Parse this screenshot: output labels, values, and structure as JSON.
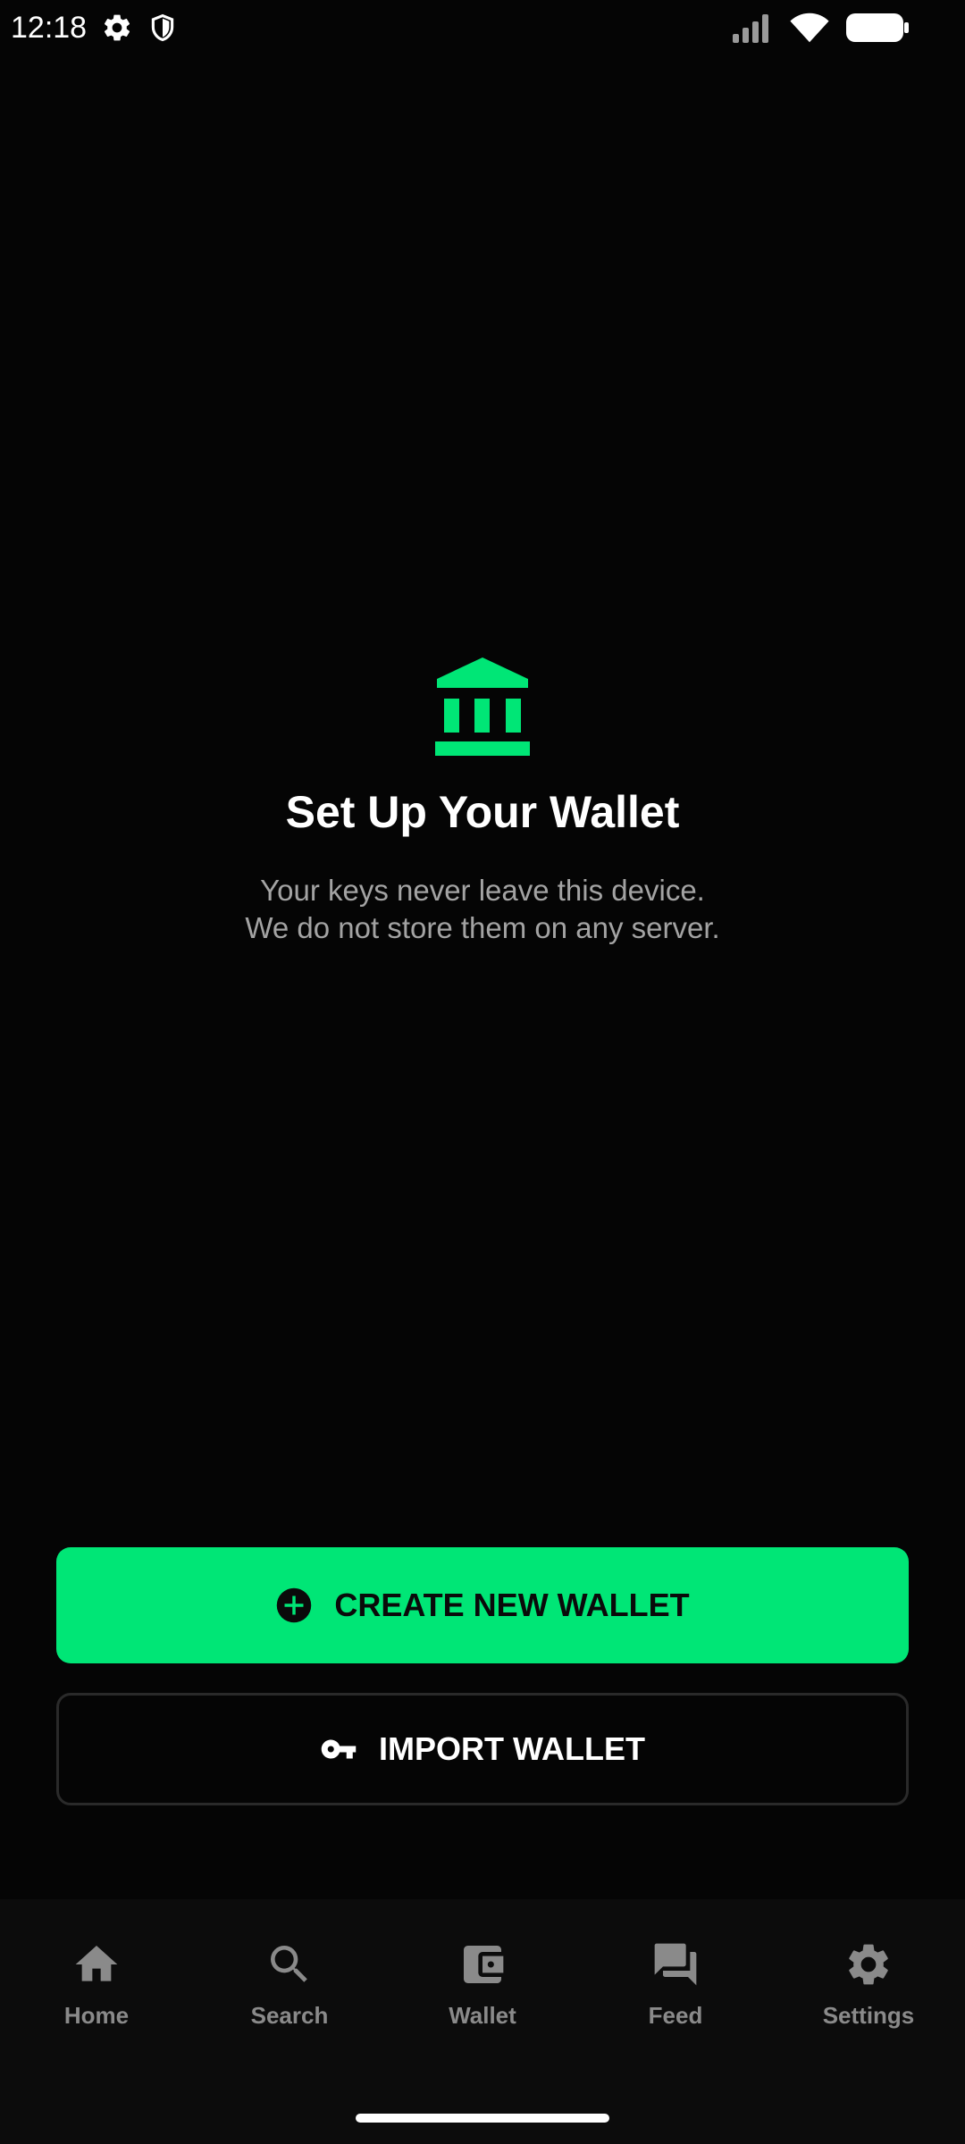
{
  "status_bar": {
    "time": "12:18",
    "icons": [
      "settings-gear-icon",
      "shield-icon",
      "signal-icon",
      "wifi-icon",
      "battery-icon"
    ]
  },
  "hero": {
    "icon": "bank-icon",
    "title": "Set Up Your Wallet",
    "subtitle_line1": "Your keys never leave this device.",
    "subtitle_line2": "We do not store them on any server."
  },
  "actions": {
    "create": {
      "label": "CREATE NEW WALLET",
      "icon": "add-circle-icon"
    },
    "import": {
      "label": "IMPORT WALLET",
      "icon": "key-icon"
    }
  },
  "nav": {
    "items": [
      {
        "label": "Home",
        "icon": "home-icon"
      },
      {
        "label": "Search",
        "icon": "search-icon"
      },
      {
        "label": "Wallet",
        "icon": "wallet-icon"
      },
      {
        "label": "Feed",
        "icon": "forum-icon"
      },
      {
        "label": "Settings",
        "icon": "settings-icon"
      }
    ]
  },
  "colors": {
    "background": "#050505",
    "accent": "#00e676",
    "nav_background": "#0c0c0c",
    "muted_text": "#a3a3a3",
    "nav_icon": "#8a8a8a"
  }
}
